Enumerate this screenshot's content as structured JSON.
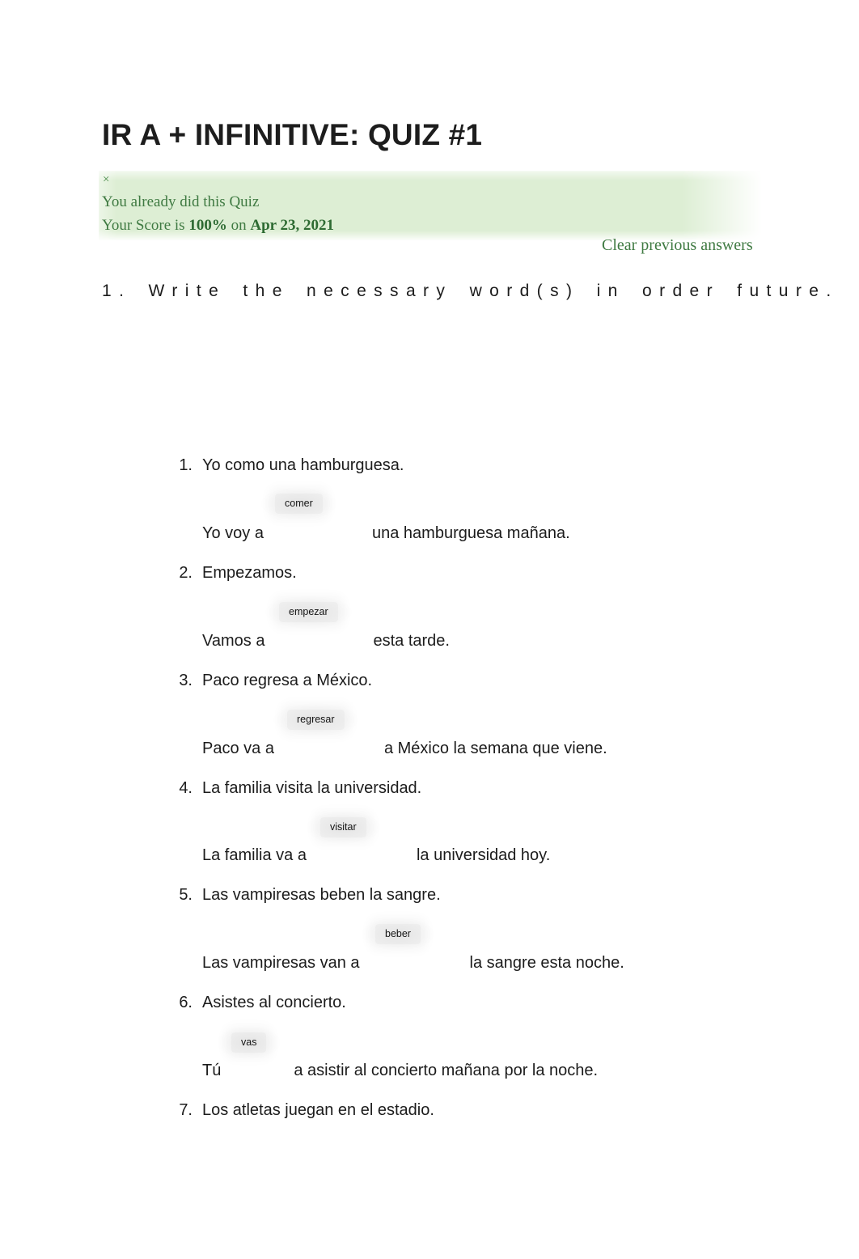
{
  "document": {
    "title": "IR A + INFINITIVE: QUIZ #1"
  },
  "alert": {
    "close_icon": "close-icon",
    "close_glyph": "×",
    "line1": "You already did this Quiz",
    "score_prefix": "Your Score is ",
    "score_value": "100%",
    "score_middle": " on ",
    "score_date": "Apr 23, 2021",
    "clear_link": "Clear previous answers",
    "background_color": "#ddeed4",
    "text_color": "#3f7a42"
  },
  "instruction": {
    "text": "1. Write the necessary word(s) in order future."
  },
  "questions": [
    {
      "number": "1.",
      "prompt": "Yo como una hamburguesa.",
      "hint": "comer",
      "answer_before": "Yo voy a",
      "answer_after": "una hamburguesa mañana."
    },
    {
      "number": "2.",
      "prompt": "Empezamos.",
      "hint": "empezar",
      "answer_before": "Vamos a",
      "answer_after": "esta tarde."
    },
    {
      "number": "3.",
      "prompt": "Paco regresa a México.",
      "hint": "regresar",
      "answer_before": "Paco va a",
      "answer_after": "a México la semana que viene."
    },
    {
      "number": "4.",
      "prompt": "La familia visita la universidad.",
      "hint": "visitar",
      "answer_before": "La familia va a",
      "answer_after": "la universidad hoy."
    },
    {
      "number": "5.",
      "prompt": "Las vampiresas beben la sangre.",
      "hint": "beber",
      "answer_before": "Las vampiresas van a",
      "answer_after": "la sangre esta noche."
    },
    {
      "number": "6.",
      "prompt": "Asistes al concierto.",
      "hint": "vas",
      "answer_before": "Tú",
      "answer_after": "a asistir al concierto mañana por la noche."
    },
    {
      "number": "7.",
      "prompt": "Los atletas juegan en el estadio.",
      "hint": "",
      "answer_before": "",
      "answer_after": ""
    }
  ]
}
